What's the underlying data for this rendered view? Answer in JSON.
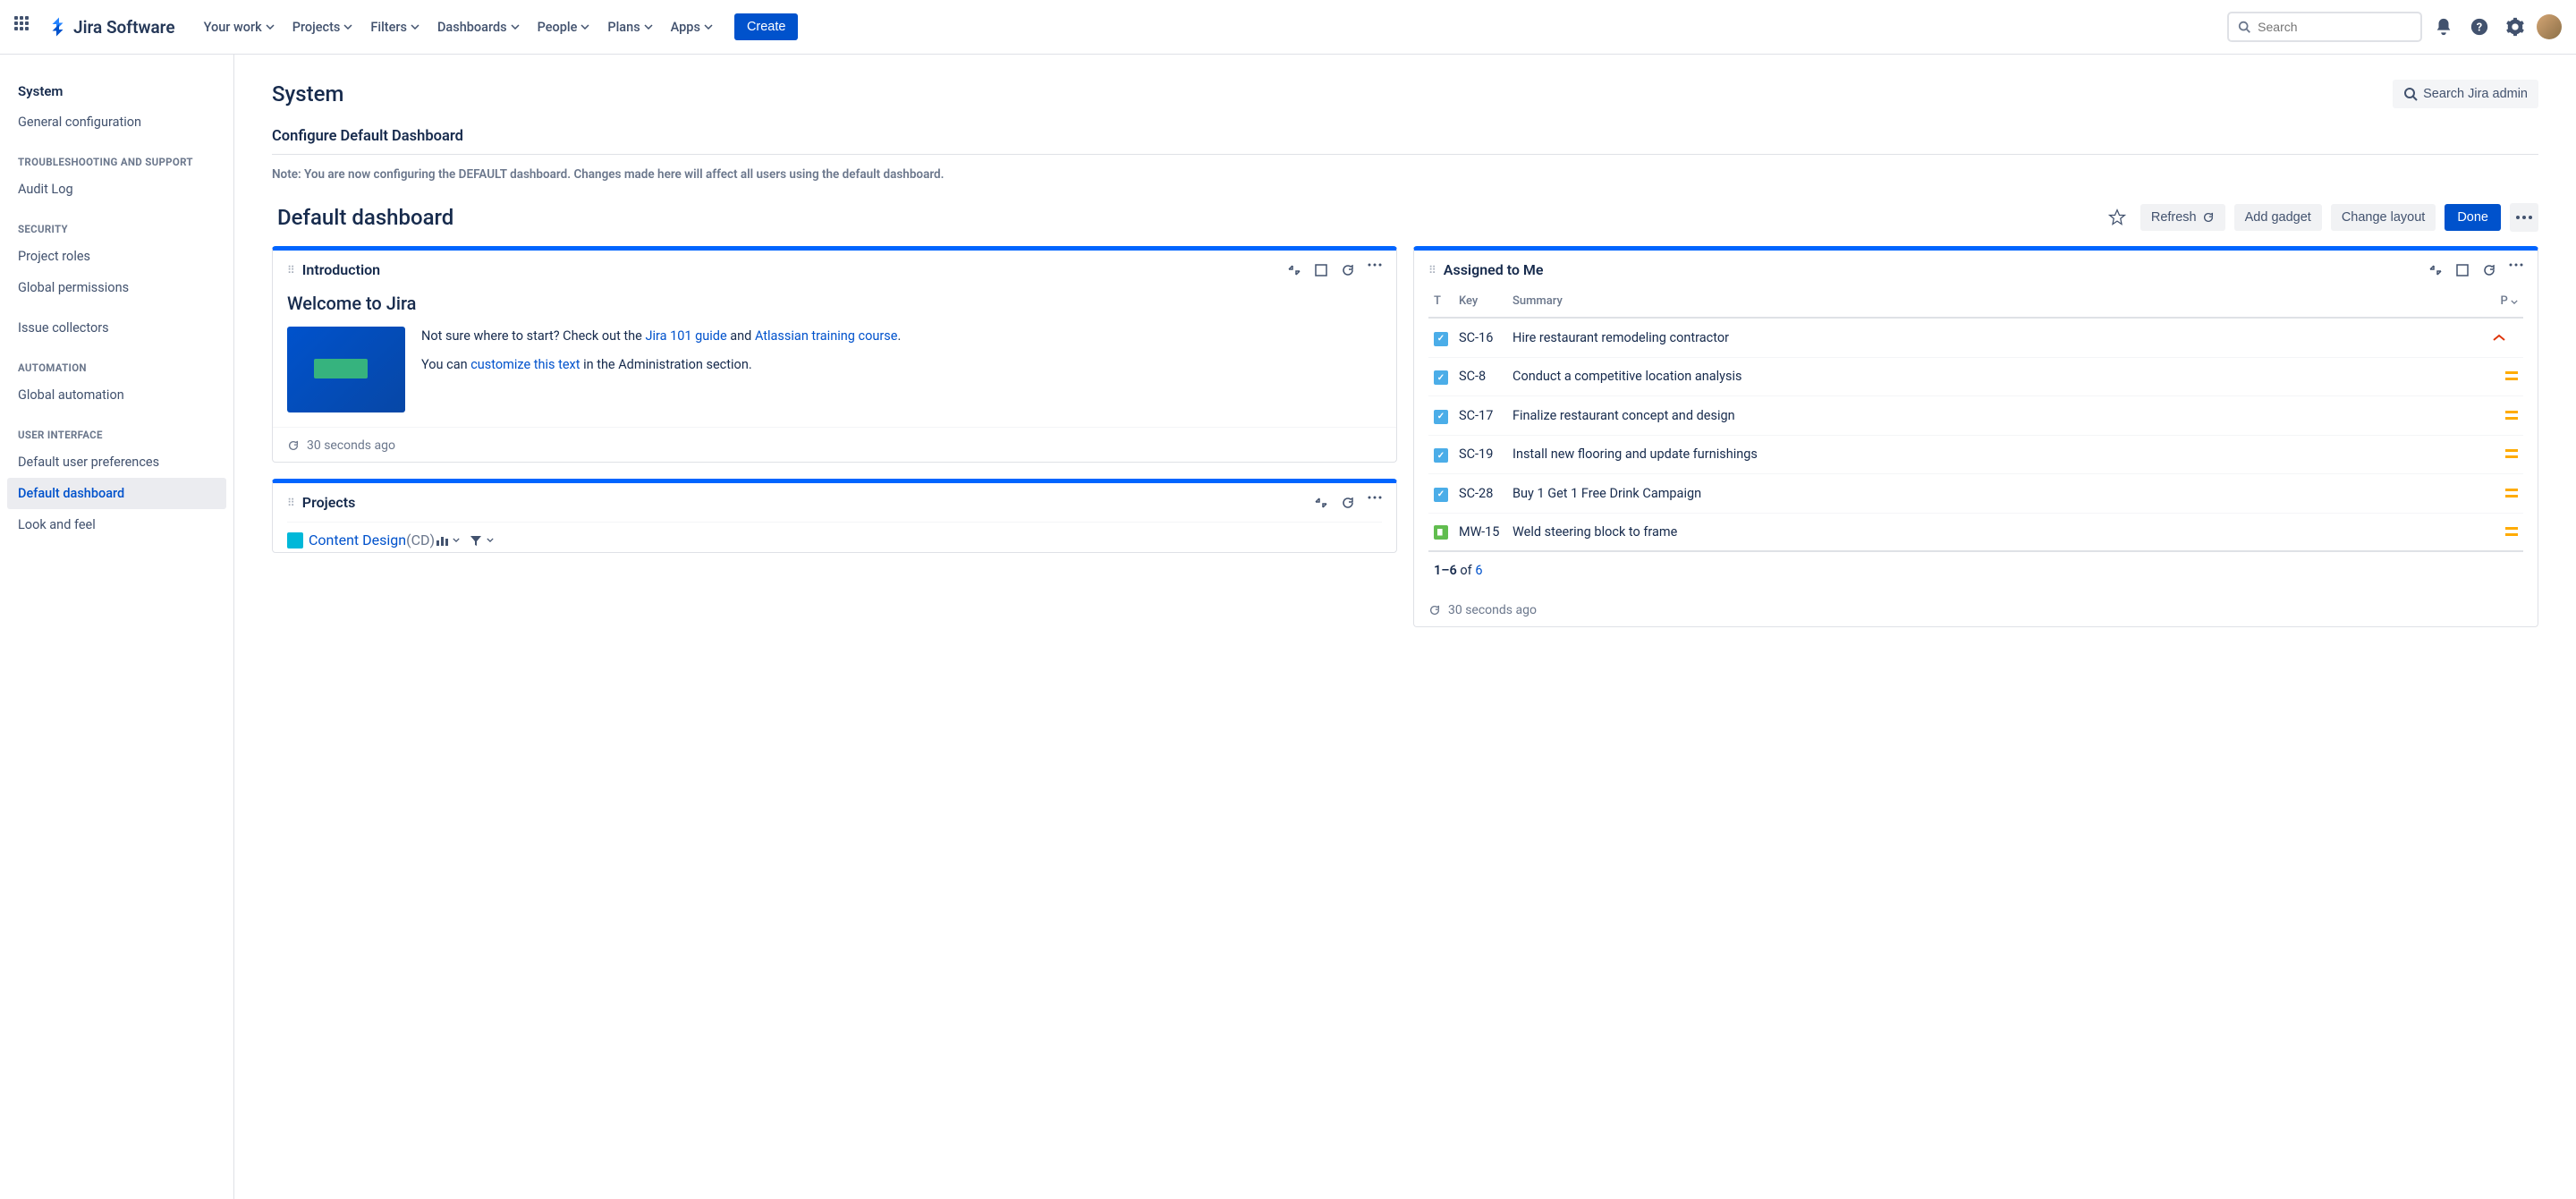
{
  "topnav": {
    "logo_text": "Jira Software",
    "items": [
      "Your work",
      "Projects",
      "Filters",
      "Dashboards",
      "People",
      "Plans",
      "Apps"
    ],
    "create": "Create",
    "search_placeholder": "Search"
  },
  "sidebar": {
    "heading": "System",
    "item_general": "General configuration",
    "groups": [
      {
        "label": "TROUBLESHOOTING AND SUPPORT",
        "items": [
          "Audit Log"
        ]
      },
      {
        "label": "SECURITY",
        "items": [
          "Project roles",
          "Global permissions",
          "Issue collectors"
        ]
      },
      {
        "label": "AUTOMATION",
        "items": [
          "Global automation"
        ]
      },
      {
        "label": "USER INTERFACE",
        "items": [
          "Default user preferences",
          "Default dashboard",
          "Look and feel"
        ]
      }
    ]
  },
  "page": {
    "title": "System",
    "search_admin": "Search Jira admin",
    "subheading": "Configure Default Dashboard",
    "note": "Note: You are now configuring the DEFAULT dashboard. Changes made here will affect all users using the default dashboard."
  },
  "dashboard": {
    "title": "Default dashboard",
    "refresh": "Refresh",
    "add_gadget": "Add gadget",
    "change_layout": "Change layout",
    "done": "Done"
  },
  "introduction": {
    "title": "Introduction",
    "heading": "Welcome to Jira",
    "p1_a": "Not sure where to start? Check out the ",
    "link1": "Jira 101 guide",
    "p1_b": " and ",
    "link2": "Atlassian training course",
    "p1_c": ".",
    "p2_a": "You can ",
    "link3": "customize this text",
    "p2_b": " in the Administration section.",
    "footer": "30 seconds ago"
  },
  "projects": {
    "title": "Projects",
    "item_name": "Content Design",
    "item_key": " (CD)"
  },
  "assigned": {
    "title": "Assigned to Me",
    "cols": {
      "t": "T",
      "key": "Key",
      "summary": "Summary",
      "p": "P"
    },
    "rows": [
      {
        "type": "task",
        "key": "SC-16",
        "summary": "Hire restaurant remodeling contractor",
        "prio": "high"
      },
      {
        "type": "task",
        "key": "SC-8",
        "summary": "Conduct a competitive location analysis",
        "prio": "medium"
      },
      {
        "type": "task",
        "key": "SC-17",
        "summary": "Finalize restaurant concept and design",
        "prio": "medium"
      },
      {
        "type": "task",
        "key": "SC-19",
        "summary": "Install new flooring and update furnishings",
        "prio": "medium"
      },
      {
        "type": "task",
        "key": "SC-28",
        "summary": "Buy 1 Get 1 Free Drink Campaign",
        "prio": "medium"
      },
      {
        "type": "story",
        "key": "MW-15",
        "summary": "Weld steering block to frame",
        "prio": "medium"
      }
    ],
    "pagination_a": "1–6",
    "pagination_b": " of ",
    "pagination_link": "6",
    "footer": "30 seconds ago"
  }
}
